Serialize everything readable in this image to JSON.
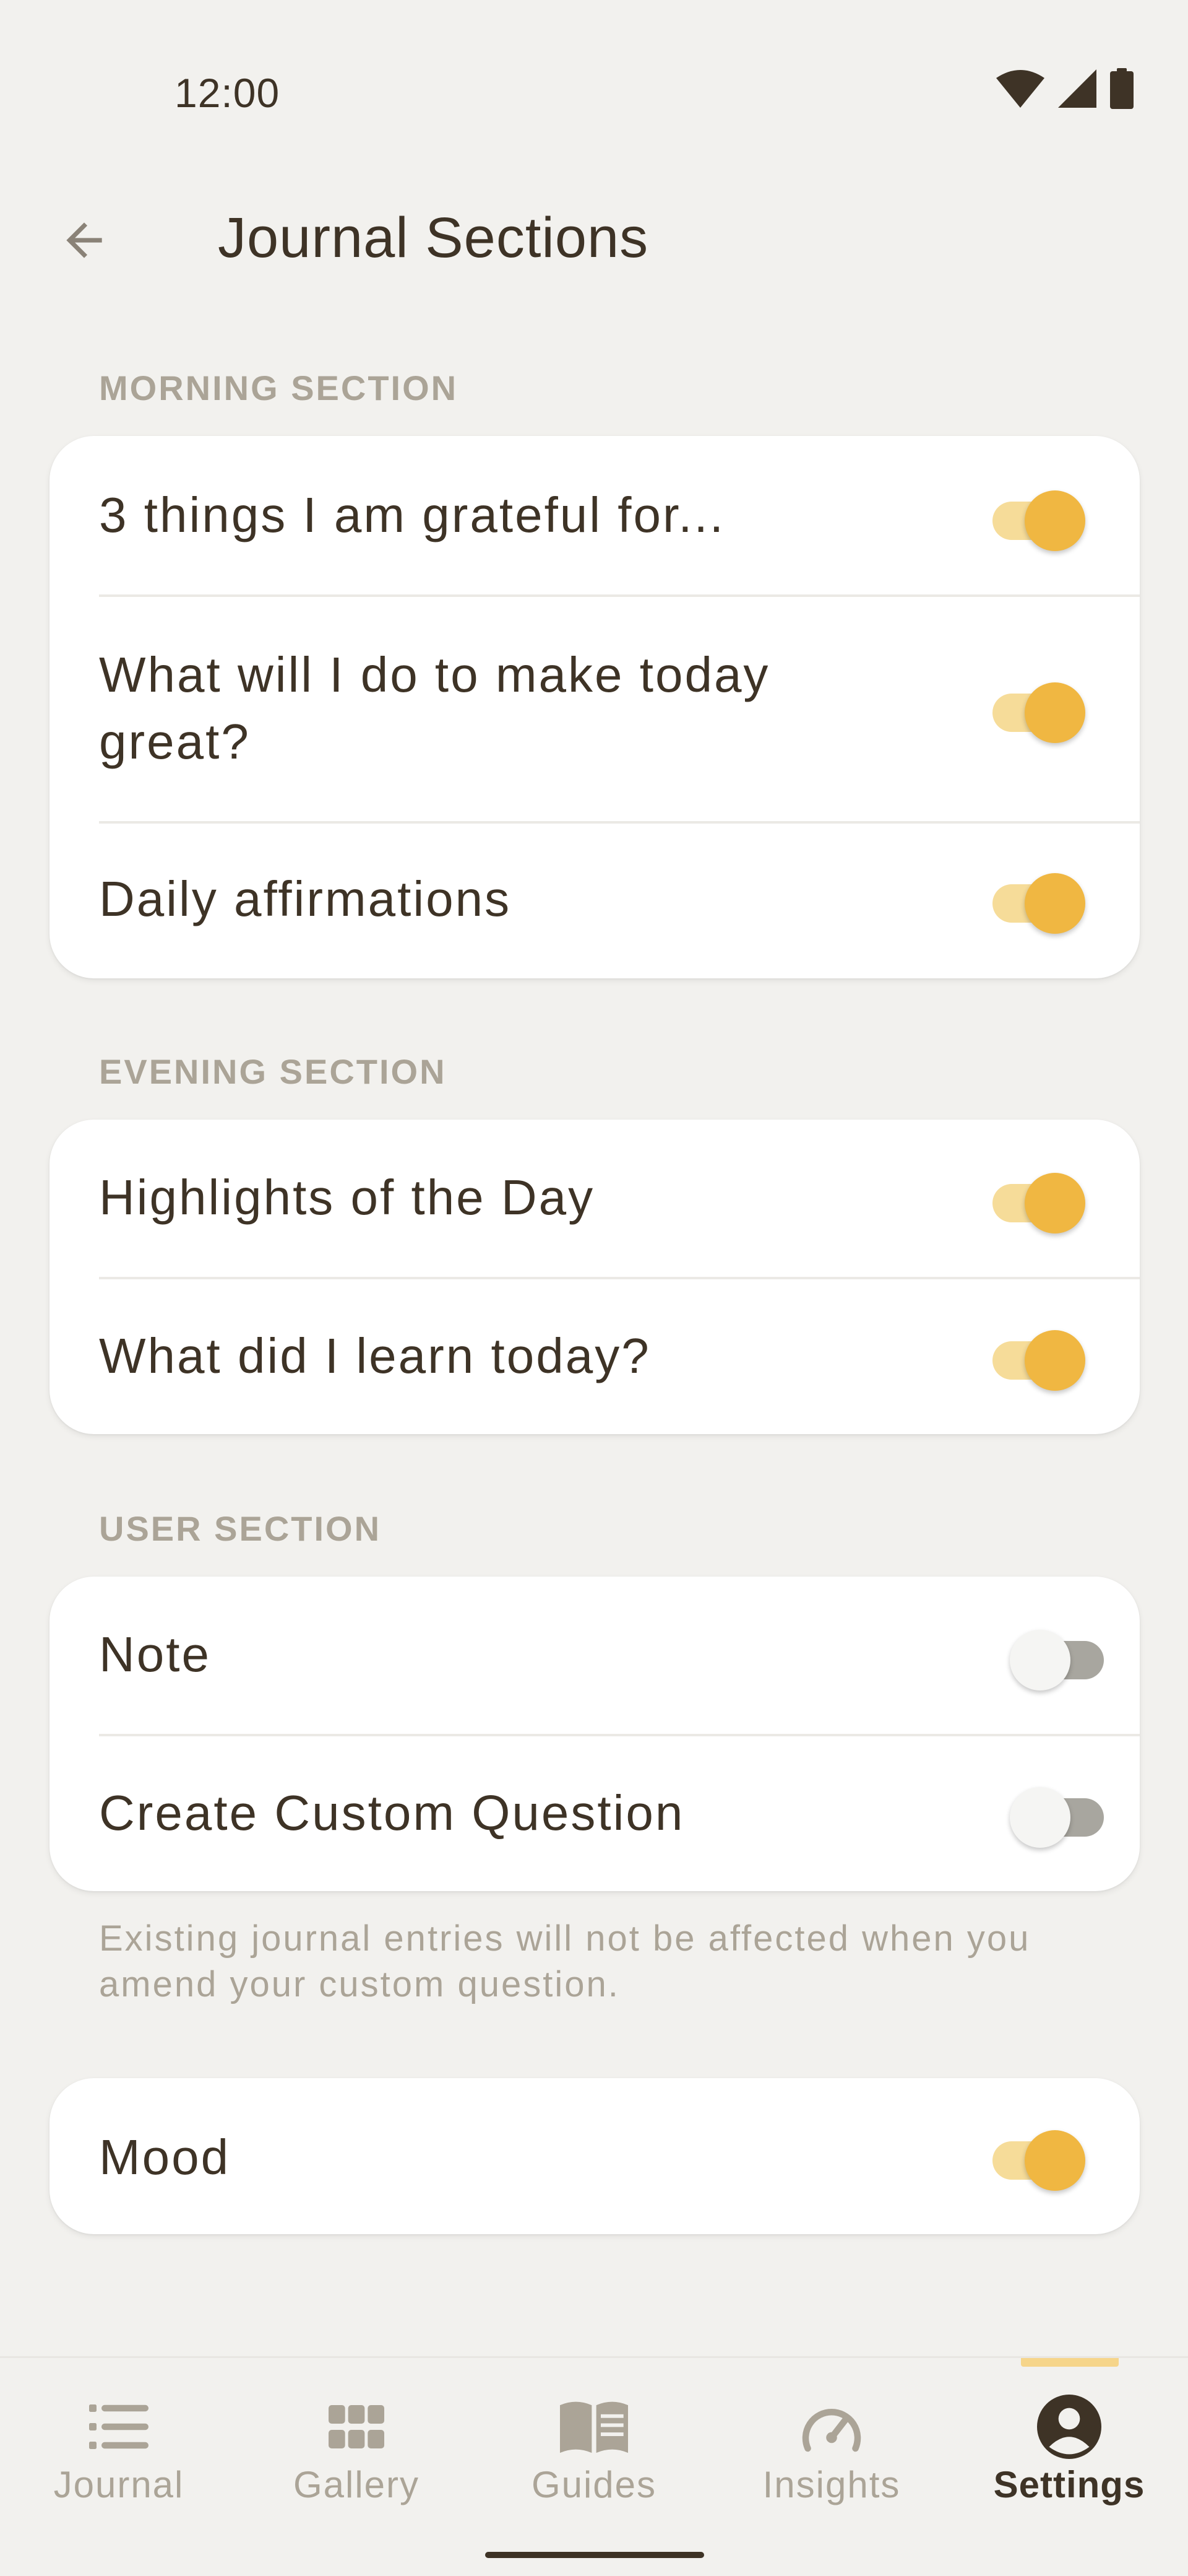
{
  "status_bar": {
    "time": "12:00",
    "icons": [
      "wifi-icon",
      "cell-signal-icon",
      "battery-icon"
    ]
  },
  "app_bar": {
    "back_icon": "arrow-back-icon",
    "title": "Journal Sections"
  },
  "sections": {
    "morning": {
      "header": "MORNING SECTION",
      "items": [
        {
          "label": "3 things I am grateful for...",
          "enabled": true
        },
        {
          "label_line1": "What will I do to make today",
          "label_line2": "great?",
          "enabled": true
        },
        {
          "label": "Daily affirmations",
          "enabled": true
        }
      ]
    },
    "evening": {
      "header": "EVENING SECTION",
      "items": [
        {
          "label": "Highlights of the Day",
          "enabled": true
        },
        {
          "label": "What did I learn today?",
          "enabled": true
        }
      ]
    },
    "user": {
      "header": "USER SECTION",
      "items": [
        {
          "label": "Note",
          "enabled": false
        },
        {
          "label": "Create Custom Question",
          "enabled": false
        }
      ],
      "footnote": "Existing journal entries will not be affected when you amend your custom question."
    },
    "mood": {
      "items": [
        {
          "label": "Mood",
          "enabled": true
        }
      ]
    }
  },
  "bottom_nav": {
    "items": [
      {
        "label": "Journal",
        "icon": "list-icon",
        "active": false
      },
      {
        "label": "Gallery",
        "icon": "grid-icon",
        "active": false
      },
      {
        "label": "Guides",
        "icon": "book-icon",
        "active": false
      },
      {
        "label": "Insights",
        "icon": "gauge-icon",
        "active": false
      },
      {
        "label": "Settings",
        "icon": "account-circle-icon",
        "active": true
      }
    ]
  },
  "colors": {
    "background": "#f2f1ee",
    "card": "#ffffff",
    "text_primary": "#3e3326",
    "text_secondary": "#aba497",
    "accent": "#f0b742",
    "accent_track": "#f6dc99",
    "switch_off_track": "#a8a69f"
  }
}
